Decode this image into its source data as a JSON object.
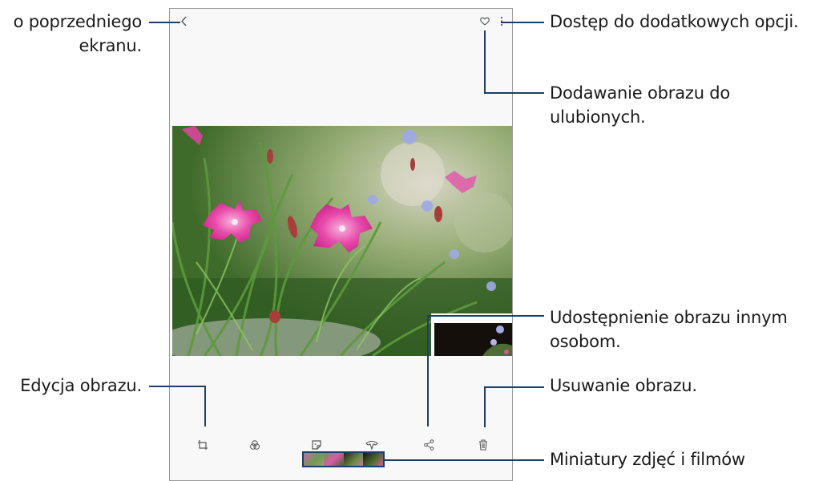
{
  "callouts": {
    "back": {
      "line1": "o poprzedniego",
      "line2": "ekranu."
    },
    "more_options": "Dostęp do dodatkowych opcji.",
    "favourite": {
      "line1": "Dodawanie obrazu do",
      "line2": "ulubionych."
    },
    "share": {
      "line1": "Udostępnienie obrazu innym",
      "line2": "osobom."
    },
    "edit": "Edycja obrazu.",
    "delete": "Usuwanie obrazu.",
    "thumbnails": "Miniatury zdjęć i filmów"
  },
  "device": {
    "top_bar": {
      "back_icon": "chevron-left-icon",
      "favourite_icon": "heart-outline-icon",
      "more_icon": "vertical-dots-icon"
    },
    "toolbar": {
      "items": [
        {
          "name": "edit-button",
          "icon": "crop-rotate-icon"
        },
        {
          "name": "filter-button",
          "icon": "three-circles-icon"
        },
        {
          "name": "sticker-button",
          "icon": "sticker-icon"
        },
        {
          "name": "stamp-button",
          "icon": "brush-icon"
        },
        {
          "name": "share-button",
          "icon": "share-icon"
        },
        {
          "name": "delete-button",
          "icon": "trash-icon"
        }
      ]
    }
  },
  "colors": {
    "callout_line": "#1c3f66",
    "petal": "#e43fa3",
    "foliage": "#4f7d35"
  }
}
